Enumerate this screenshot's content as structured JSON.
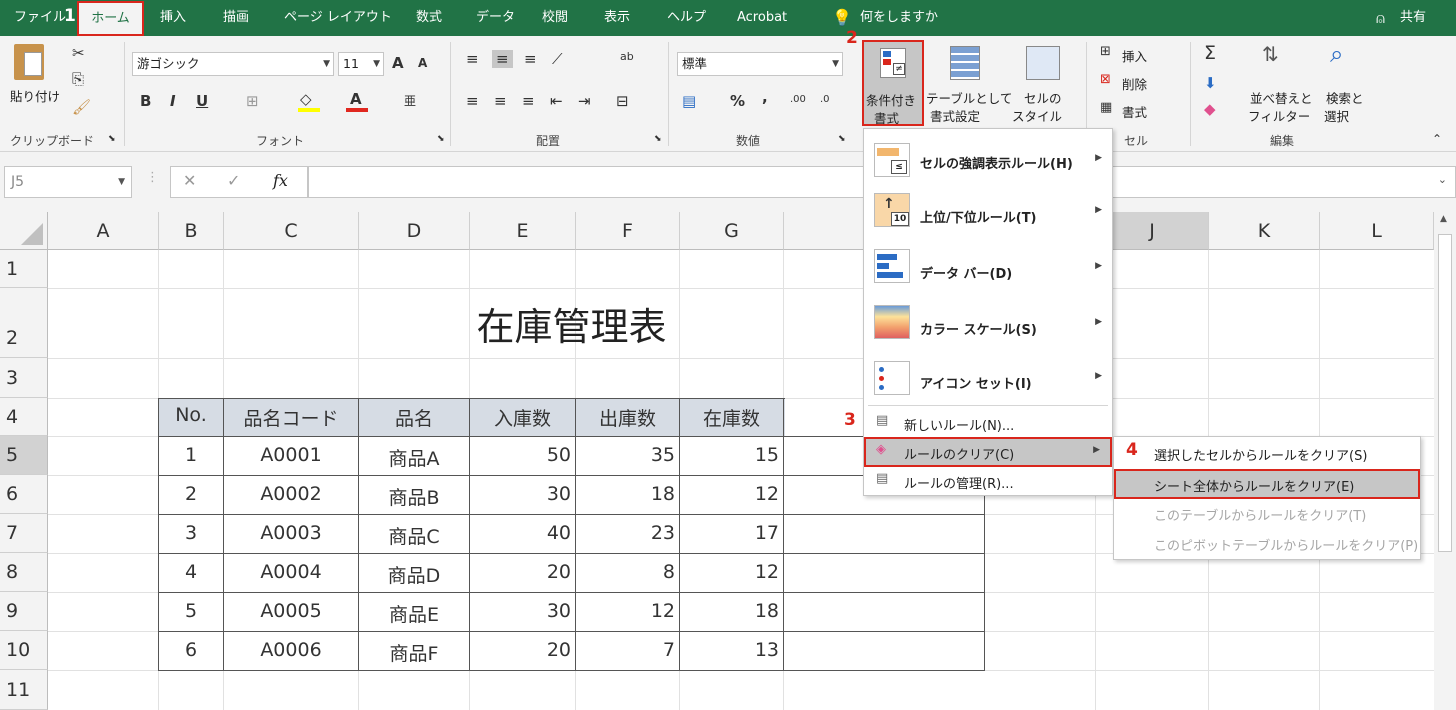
{
  "tabs": {
    "file": "ファイル",
    "home": "ホーム",
    "insert": "挿入",
    "draw": "描画",
    "page_layout": "ページ レイアウト",
    "formulas": "数式",
    "data": "データ",
    "review": "校閲",
    "view": "表示",
    "help": "ヘルプ",
    "acrobat": "Acrobat",
    "tell_me": "何をしますか",
    "share": "共有"
  },
  "steps": {
    "s1": "1",
    "s2": "2",
    "s3": "3",
    "s4": "4"
  },
  "ribbon": {
    "clipboard": {
      "paste": "貼り付け",
      "label": "クリップボード"
    },
    "font": {
      "name": "游ゴシック",
      "size": "11",
      "label": "フォント",
      "bold": "B",
      "italic": "I",
      "underline": "U",
      "grow": "A",
      "shrink": "A"
    },
    "alignment": {
      "label": "配置"
    },
    "number": {
      "format": "標準",
      "label": "数値",
      "percent": "%",
      "comma": ","
    },
    "styles": {
      "cond_format_line1": "条件付き",
      "cond_format_line2": "書式",
      "table_line1": "テーブルとして",
      "table_line2": "書式設定",
      "cell_style_line1": "セルの",
      "cell_style_line2": "スタイル"
    },
    "cells": {
      "insert": "挿入",
      "delete": "削除",
      "format": "書式",
      "label": "セル"
    },
    "editing": {
      "sum": "Σ",
      "sort_line1": "並べ替えと",
      "sort_line2": "フィルター",
      "find_line1": "検索と",
      "find_line2": "選択",
      "label": "編集"
    }
  },
  "formula_bar": {
    "name_box": "J5",
    "cancel": "✕",
    "enter": "✓",
    "fx": "fx",
    "value": ""
  },
  "columns": [
    "A",
    "B",
    "C",
    "D",
    "E",
    "F",
    "G",
    "J",
    "K",
    "L"
  ],
  "rows": [
    "1",
    "2",
    "3",
    "4",
    "5",
    "6",
    "7",
    "8",
    "9",
    "10",
    "11"
  ],
  "sheet": {
    "title": "在庫管理表",
    "headers": [
      "No.",
      "品名コード",
      "品名",
      "入庫数",
      "出庫数",
      "在庫数"
    ],
    "data": [
      [
        "1",
        "A0001",
        "商品A",
        "50",
        "35",
        "15"
      ],
      [
        "2",
        "A0002",
        "商品B",
        "30",
        "18",
        "12"
      ],
      [
        "3",
        "A0003",
        "商品C",
        "40",
        "23",
        "17"
      ],
      [
        "4",
        "A0004",
        "商品D",
        "20",
        "8",
        "12"
      ],
      [
        "5",
        "A0005",
        "商品E",
        "30",
        "12",
        "18"
      ],
      [
        "6",
        "A0006",
        "商品F",
        "20",
        "7",
        "13"
      ]
    ]
  },
  "menu": {
    "highlight": "セルの強調表示ルール(H)",
    "topbottom": "上位/下位ルール(T)",
    "databar": "データ バー(D)",
    "colorscale": "カラー スケール(S)",
    "iconset": "アイコン セット(I)",
    "new_rule": "新しいルール(N)...",
    "clear_rules": "ルールのクリア(C)",
    "manage_rules": "ルールの管理(R)...",
    "icon_topbottom_num": "10"
  },
  "submenu": {
    "selected": "選択したセルからルールをクリア(S)",
    "whole_sheet": "シート全体からルールをクリア(E)",
    "table": "このテーブルからルールをクリア(T)",
    "pivot": "このピボットテーブルからルールをクリア(P)"
  }
}
